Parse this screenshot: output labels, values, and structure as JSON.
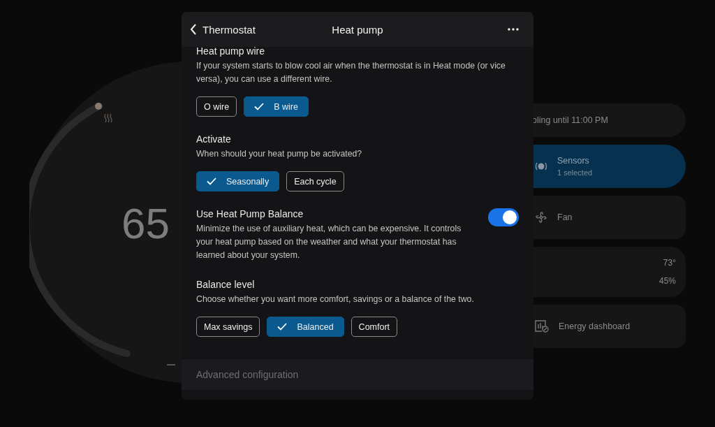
{
  "background": {
    "dial": {
      "temperature": "65"
    },
    "cards": [
      {
        "kind": "status",
        "text": "oling until 11:00 PM"
      },
      {
        "kind": "sensors",
        "title": "Sensors",
        "subtitle": "1 selected",
        "selected": true
      },
      {
        "kind": "fan",
        "title": "Fan"
      },
      {
        "kind": "readings",
        "values": [
          "73°",
          "45%"
        ]
      },
      {
        "kind": "energy",
        "title": "Energy dashboard"
      }
    ]
  },
  "dialog": {
    "back_label": "Thermostat",
    "title": "Heat pump",
    "sections": [
      {
        "kind": "chips",
        "title": "Heat pump wire",
        "description": "If your system starts to blow cool air when the thermostat is in Heat mode (or vice versa), you can use a different wire.",
        "options": [
          {
            "label": "O wire",
            "selected": false
          },
          {
            "label": "B wire",
            "selected": true
          }
        ]
      },
      {
        "kind": "chips",
        "title": "Activate",
        "description": "When should your heat pump be activated?",
        "options": [
          {
            "label": "Seasonally",
            "selected": true
          },
          {
            "label": "Each cycle",
            "selected": false
          }
        ]
      },
      {
        "kind": "toggle",
        "title": "Use Heat Pump Balance",
        "description": "Minimize the use of auxiliary heat, which can be expensive. It controls your heat pump based on the weather and what your thermostat has learned about your system.",
        "on": true
      },
      {
        "kind": "chips",
        "title": "Balance level",
        "description": "Choose whether you want more comfort, savings or a balance of the two.",
        "options": [
          {
            "label": "Max savings",
            "selected": false
          },
          {
            "label": "Balanced",
            "selected": true
          },
          {
            "label": "Comfort",
            "selected": false
          }
        ]
      }
    ],
    "footer": "Advanced configuration"
  }
}
